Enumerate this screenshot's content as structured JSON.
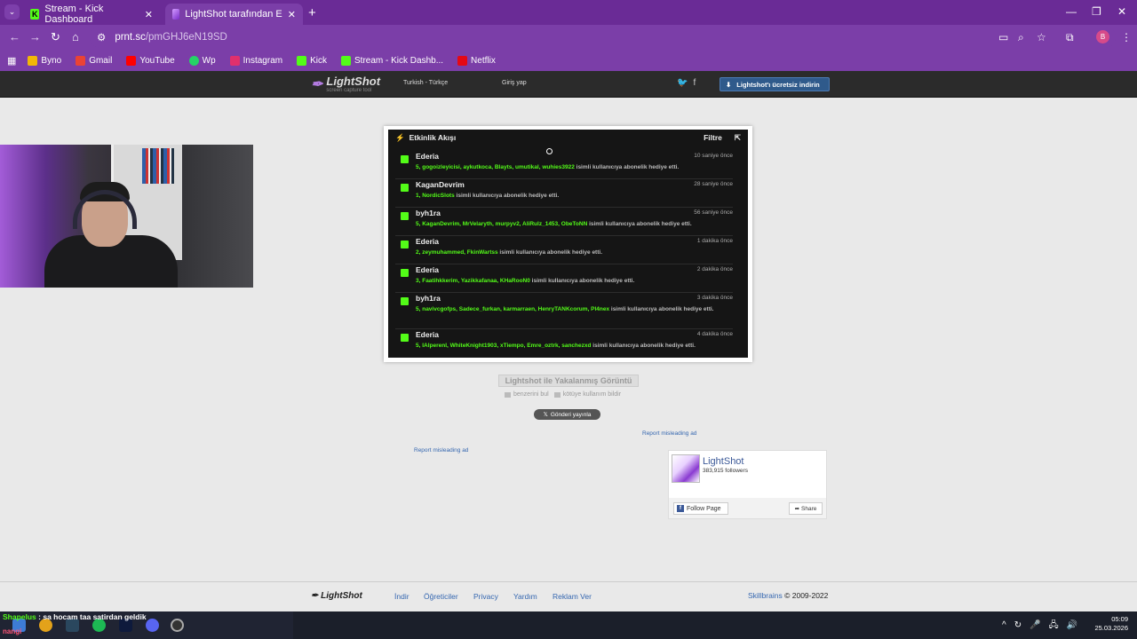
{
  "browser": {
    "tabs": [
      {
        "label": "Stream - Kick Dashboard",
        "close": "✕"
      },
      {
        "label": "LightShot tarafından Ekran Görü",
        "close": "✕"
      }
    ],
    "new_tab": "+",
    "url_domain": "prnt.sc",
    "url_path": "/pmGHJ6eN19SD",
    "profile_letter": "B",
    "window_controls": [
      "—",
      "❐",
      "✕"
    ],
    "bookmarks": [
      {
        "label": "Byno",
        "color": "#f2b705"
      },
      {
        "label": "Gmail",
        "color": "#ea4335"
      },
      {
        "label": "YouTube",
        "color": "#ff0000"
      },
      {
        "label": "Wp",
        "color": "#25d366"
      },
      {
        "label": "Instagram",
        "color": "#e1306c"
      },
      {
        "label": "Kick",
        "color": "#53fc18"
      },
      {
        "label": "Stream - Kick Dashb...",
        "color": "#53fc18"
      },
      {
        "label": "Netflix",
        "color": "#e50914"
      }
    ]
  },
  "site_header": {
    "logo": "LightShot",
    "tagline": "screen capture tool",
    "language": "Turkish - Türkçe",
    "login": "Giriş yap",
    "download_button": "Lightshot'ı ücretsiz indirin"
  },
  "feed": {
    "title": "Etkinlik Akışı",
    "filter": "Filtre",
    "rows": [
      {
        "name": "Ederia",
        "time": "10 saniye önce",
        "users": "5, gogoizleyicisi, aykutkoca, Blayts, umutikal, wuhies3922",
        "suffix": " isimli kullanıcıya abonelik hediye etti."
      },
      {
        "name": "KaganDevrim",
        "time": "28 saniye önce",
        "users": "1, NordicSlots",
        "suffix": " isimli kullanıcıya abonelik hediye etti."
      },
      {
        "name": "byh1ra",
        "time": "56 saniye önce",
        "users": "5, KaganDevrim, MrVelaryth, murpyv2, AliRulz_1453, ObeToNN",
        "suffix": " isimli kullanıcıya abonelik hediye etti."
      },
      {
        "name": "Ederia",
        "time": "1 dakika önce",
        "users": "2, zeymuhammed, FkinWartss",
        "suffix": " isimli kullanıcıya abonelik hediye etti."
      },
      {
        "name": "Ederia",
        "time": "2 dakika önce",
        "users": "3, Faatihkkerim, Yazikkafanaa, KHaRooN0",
        "suffix": " isimli kullanıcıya abonelik hediye etti."
      },
      {
        "name": "byh1ra",
        "time": "3 dakika önce",
        "users": "5, navivcgofps, Sadece_furkan, karmarraen, HenryTANKcorum, Pl4nex",
        "suffix": " isimli kullanıcıya abonelik hediye etti."
      },
      {
        "name": "Ederia",
        "time": "4 dakika önce",
        "users": "5, IAlperenl, WhiteKnight1903, xTiempo, Emre_oztrk, sanchezxd",
        "suffix": " isimli kullanıcıya abonelik hediye etti."
      }
    ]
  },
  "below_shot": {
    "caption": "Lightshot ile Yakalanmış Görüntü",
    "find_similar": "benzerini bul",
    "report_abuse": "kötüye kullanım bildir",
    "tweet": "Gönderi yayınla",
    "report_ad_1": "Report misleading ad",
    "report_ad_2": "Report misleading ad"
  },
  "facebook": {
    "name": "LightShot",
    "followers": "383,915 followers",
    "follow": "Follow Page",
    "share": "Share"
  },
  "footer": {
    "logo": "LightShot",
    "links": [
      "İndir",
      "Öğreticiler",
      "Privacy",
      "Yardım",
      "Reklam Ver"
    ],
    "company": "Skillbrains",
    "copyright": " © 2009-2022"
  },
  "overlay_chat": {
    "user": "Shapelus",
    "message": " : sa hocam taa satirdan geldik",
    "user2": "nangi"
  },
  "taskbar": {
    "time": "05:09",
    "date": "25.03.2026"
  }
}
